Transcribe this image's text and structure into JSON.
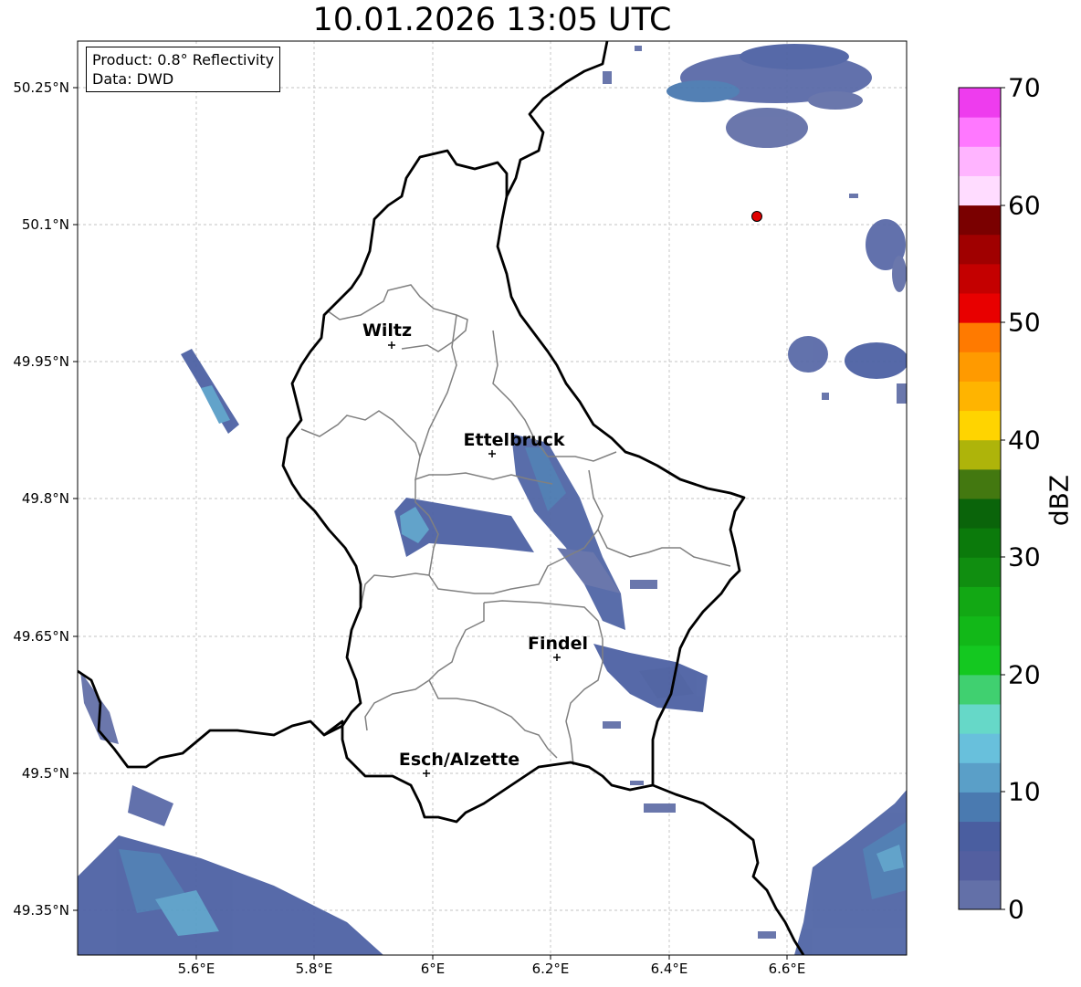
{
  "title": "10.01.2026 13:05 UTC",
  "info_box": {
    "product": "Product: 0.8° Reflectivity",
    "source": "Data: DWD"
  },
  "map": {
    "lon_range": [
      5.4,
      6.8
    ],
    "lat_range": [
      49.3,
      50.3
    ],
    "x_ticks": [
      "5.6°E",
      "5.8°E",
      "6°E",
      "6.2°E",
      "6.4°E",
      "6.6°E"
    ],
    "y_ticks": [
      "50.25°N",
      "50.1°N",
      "49.95°N",
      "49.8°N",
      "49.65°N",
      "49.5°N",
      "49.35°N"
    ],
    "grid": "dashed",
    "cities": [
      {
        "name": "Wiltz",
        "lon": 5.93,
        "lat": 49.97
      },
      {
        "name": "Ettelbruck",
        "lon": 6.1,
        "lat": 49.85
      },
      {
        "name": "Findel",
        "lon": 6.21,
        "lat": 49.63
      },
      {
        "name": "Esch/Alzette",
        "lon": 5.99,
        "lat": 49.5
      }
    ],
    "radar_site": {
      "lon": 6.55,
      "lat": 50.11,
      "color": "#e00000"
    }
  },
  "colorbar": {
    "label": "dBZ",
    "ticks": [
      "0",
      "10",
      "20",
      "30",
      "40",
      "50",
      "60",
      "70"
    ],
    "range": [
      0,
      70
    ],
    "colors": [
      "#6370a8",
      "#535fa0",
      "#4a5ea0",
      "#4a7ab0",
      "#5a9fc8",
      "#68c0dc",
      "#66d8c8",
      "#40d070",
      "#14c820",
      "#12b818",
      "#12a814",
      "#108e10",
      "#0b7a0b",
      "#0a640a",
      "#437810",
      "#aeb40a",
      "#ffd400",
      "#ffb400",
      "#ff9a00",
      "#ff7a00",
      "#e80000",
      "#c40000",
      "#a00000",
      "#7a0000",
      "#ffdcff",
      "#ffb4ff",
      "#ff78ff",
      "#ee3cee"
    ]
  }
}
